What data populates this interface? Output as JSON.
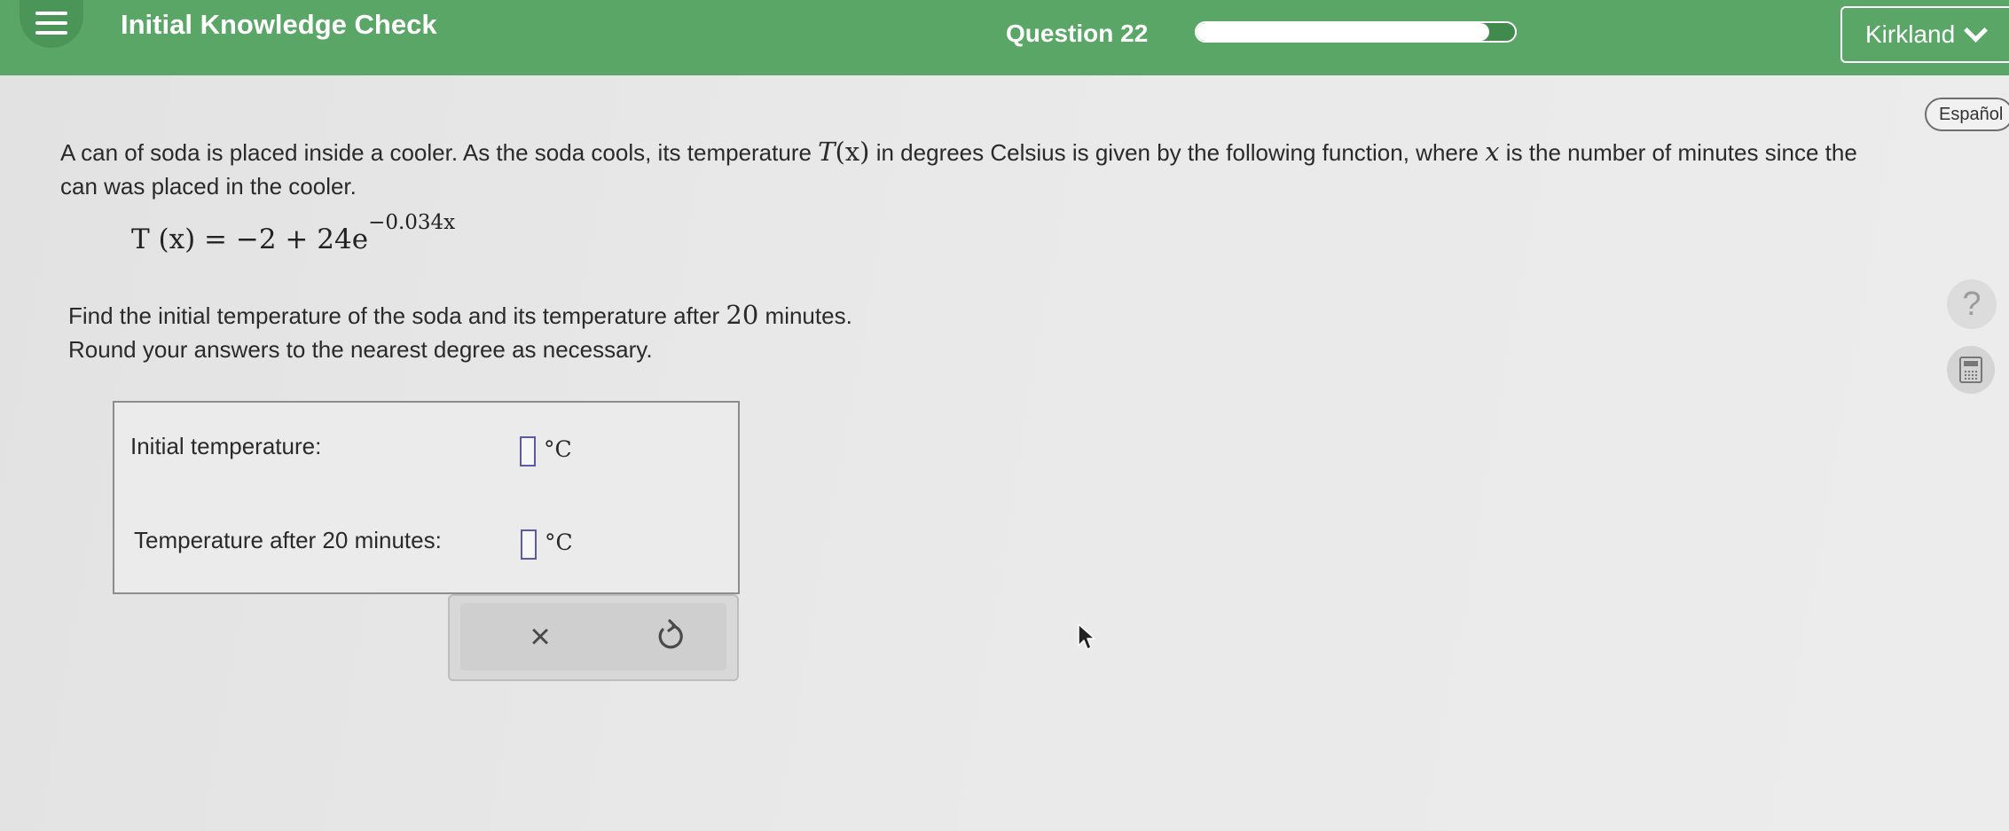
{
  "header": {
    "title": "Initial Knowledge Check",
    "question_label": "Question 22",
    "progress_fraction": 0.92,
    "user_name": "Kirkland"
  },
  "side_tools": {
    "language_label": "Español",
    "help_symbol": "?"
  },
  "problem": {
    "intro_part1": "A can of soda is placed inside a cooler. As the soda cools, its temperature ",
    "intro_func": "T",
    "intro_arg": "(x)",
    "intro_part2": " in degrees Celsius is given by the following function, where ",
    "intro_var": "x",
    "intro_part3": " is the number of minutes since the can was placed in the cooler.",
    "formula_lhs": "T (x) = −2 + 24e",
    "formula_exponent": "−0.034x",
    "find_part1": "Find the initial temperature of the soda and its temperature after ",
    "find_num": "20",
    "find_part2": " minutes.",
    "round_text": "Round your answers to the nearest degree as necessary."
  },
  "answers": {
    "initial_label": "Initial temperature:",
    "initial_value": "",
    "after_label": "Temperature after 20 minutes:",
    "after_value": "",
    "unit": "°C"
  },
  "actions": {
    "clear_symbol": "×"
  },
  "colors": {
    "header_green": "#5aa667",
    "input_border": "#5a5aa6"
  }
}
